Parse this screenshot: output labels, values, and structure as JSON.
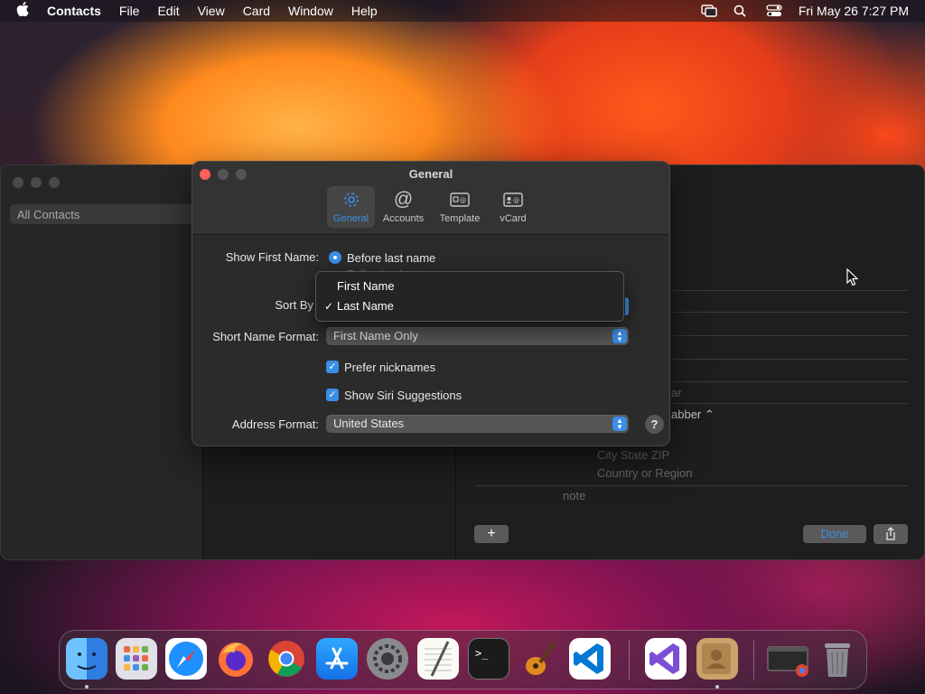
{
  "menubar": {
    "app_name": "Contacts",
    "menus": [
      "File",
      "Edit",
      "View",
      "Card",
      "Window",
      "Help"
    ],
    "datetime": "Fri May 26  7:27 PM",
    "icons": [
      "apple-icon",
      "screen-mirroring-icon",
      "search-icon",
      "control-center-icon"
    ]
  },
  "contacts_window": {
    "group": "All Contacts",
    "ghost_fields": [
      "abber",
      "City  State  ZIP",
      "Country or Region",
      "note",
      "ar"
    ],
    "done_label": "Done",
    "add_label": "+"
  },
  "prefs": {
    "title": "General",
    "tabs": [
      {
        "label": "General",
        "icon": "gear-icon",
        "active": true
      },
      {
        "label": "Accounts",
        "icon": "at-icon",
        "active": false
      },
      {
        "label": "Template",
        "icon": "template-icon",
        "active": false
      },
      {
        "label": "vCard",
        "icon": "vcard-icon",
        "active": false
      }
    ],
    "show_first_name": {
      "label": "Show First Name:",
      "selected": "Before last name",
      "other_partial": "Following last name"
    },
    "sort_by": {
      "label": "Sort By",
      "options": [
        "First Name",
        "Last Name"
      ],
      "selected": "Last Name"
    },
    "short_name_format": {
      "label": "Short Name Format:",
      "value": "First Name Only"
    },
    "prefer_nicknames": {
      "label": "Prefer nicknames",
      "checked": true
    },
    "show_siri_suggestions": {
      "label": "Show Siri Suggestions",
      "checked": true
    },
    "address_format": {
      "label": "Address Format:",
      "value": "United States"
    },
    "help": "?"
  },
  "dock": {
    "apps": [
      "Finder",
      "Launchpad",
      "Safari",
      "Firefox",
      "Chrome",
      "App Store",
      "System Settings",
      "TextEdit",
      "Terminal",
      "GarageBand",
      "VS Code",
      "Visual Studio",
      "Contacts",
      "Chrome Apps",
      "Trash"
    ]
  },
  "colors": {
    "accent": "#3a8ee6",
    "close": "#ff5f57",
    "window_bg": "#2b2b2b"
  }
}
